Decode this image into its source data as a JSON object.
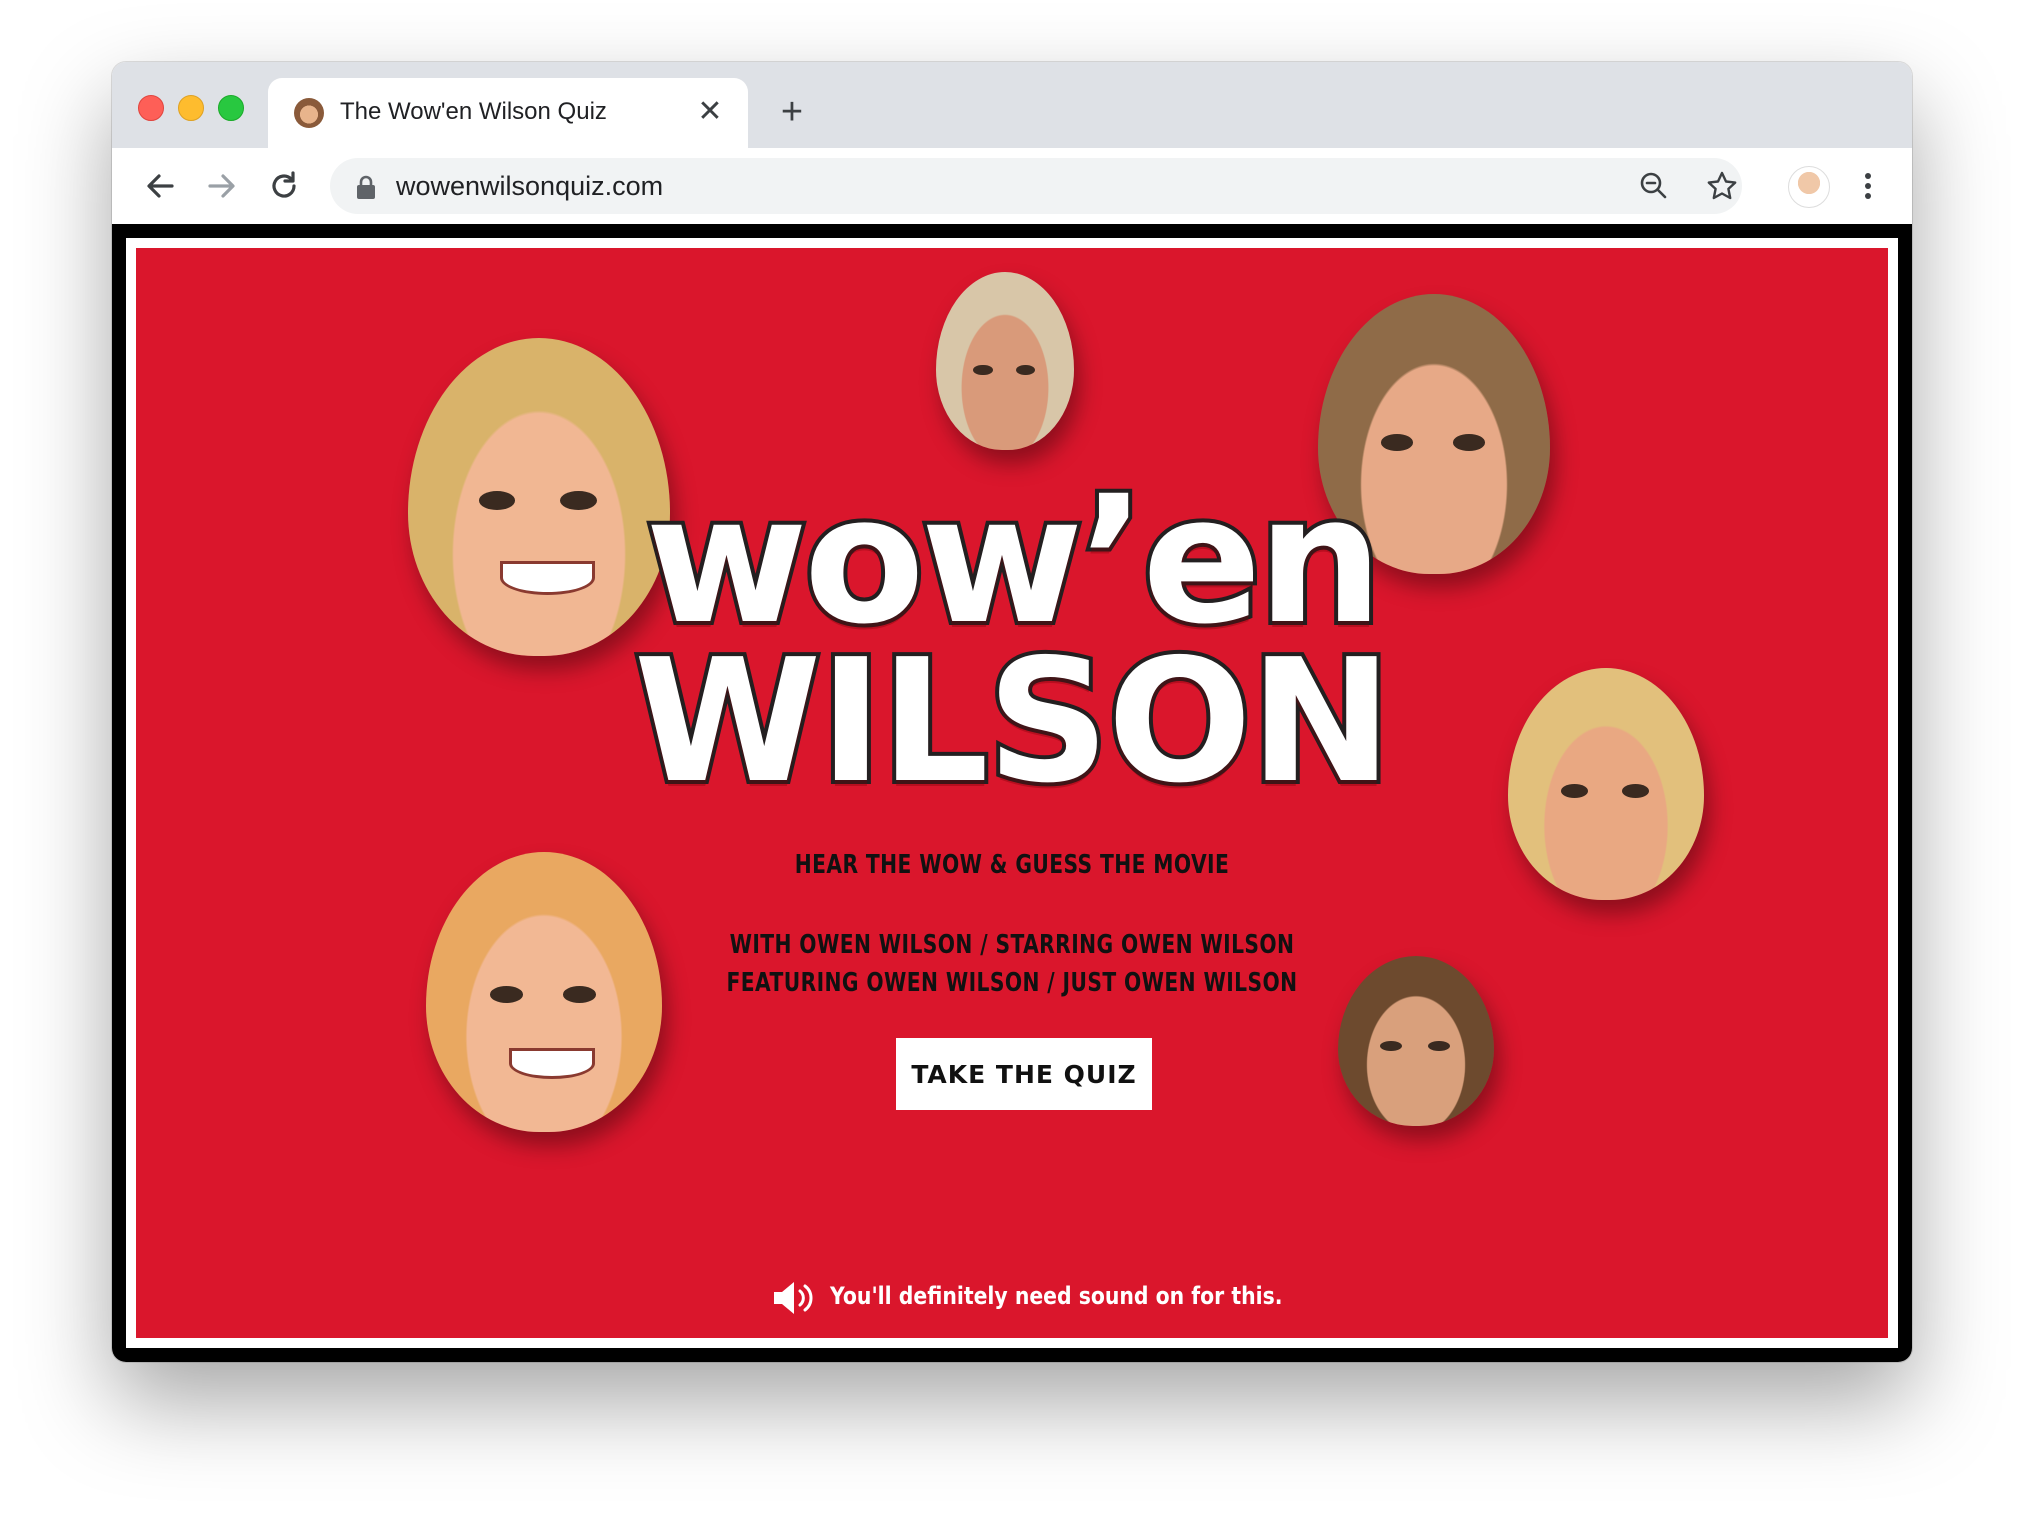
{
  "browser": {
    "tab_title": "The Wow'en Wilson Quiz",
    "tab_close": "✕",
    "new_tab": "+",
    "url": "wowenwilsonquiz.com"
  },
  "page": {
    "logo_line1": "wow’en",
    "logo_line2": "WILSON",
    "tagline": "HEAR THE WOW & GUESS THE MOVIE",
    "credits_line1": "WITH OWEN WILSON / STARRING OWEN WILSON",
    "credits_line2": "FEATURING OWEN WILSON / JUST OWEN WILSON",
    "cta_label": "TAKE THE QUIZ",
    "sound_note": "You'll definitely need sound on for this."
  },
  "colors": {
    "panel_red": "#da162c",
    "frame_black": "#000000",
    "button_white": "#ffffff",
    "tabbar_gray": "#dee1e6"
  },
  "icons": [
    "back-arrow-icon",
    "forward-arrow-icon",
    "reload-icon",
    "lock-icon",
    "zoom-icon",
    "star-icon",
    "profile-avatar",
    "menu-dots-icon",
    "speaker-icon"
  ]
}
